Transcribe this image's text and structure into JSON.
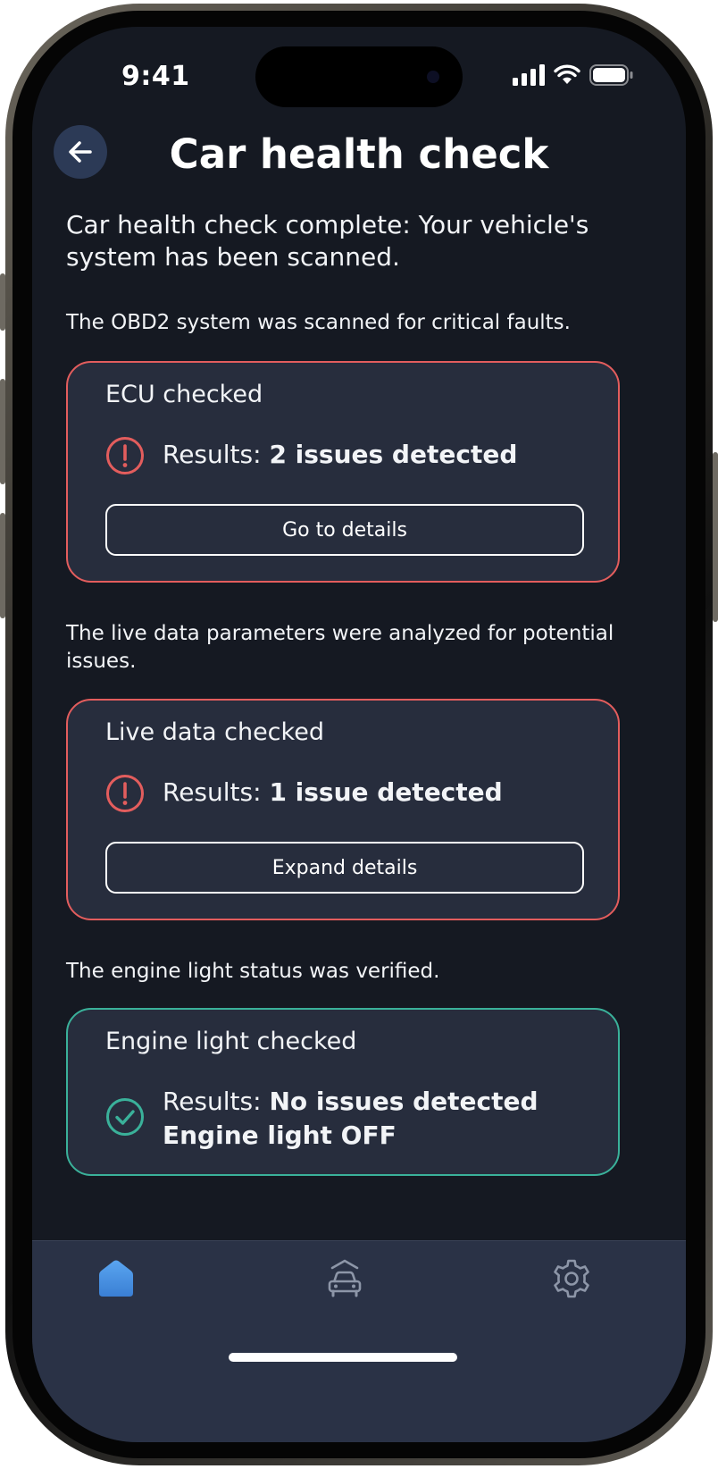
{
  "status_bar": {
    "time": "9:41"
  },
  "header": {
    "title": "Car health check"
  },
  "intro": "Car health check complete: Your vehicle's system has been scanned.",
  "sections": [
    {
      "note": "The OBD2 system was scanned for critical faults.",
      "card_title": "ECU checked",
      "result_prefix": "Results: ",
      "result_value": "2 issues detected",
      "status": "error",
      "button_label": "Go to details"
    },
    {
      "note": "The live data parameters were analyzed for potential issues.",
      "card_title": "Live data checked",
      "result_prefix": "Results: ",
      "result_value": "1 issue detected",
      "status": "error",
      "button_label": "Expand details"
    },
    {
      "note": "The engine light status was verified.",
      "card_title": "Engine light checked",
      "result_prefix": "Results: ",
      "result_value": "No issues detected",
      "result_value_line2": "Engine light OFF",
      "status": "ok"
    }
  ],
  "tab_bar": {
    "items": [
      {
        "icon": "home-icon",
        "active": true
      },
      {
        "icon": "car-icon",
        "active": false
      },
      {
        "icon": "gear-icon",
        "active": false
      }
    ]
  },
  "colors": {
    "background": "#151922",
    "card": "#272d3d",
    "error": "#e35d5d",
    "ok": "#3ab19a",
    "accent": "#4a8fe0",
    "tab_bar": "#2a3246"
  }
}
